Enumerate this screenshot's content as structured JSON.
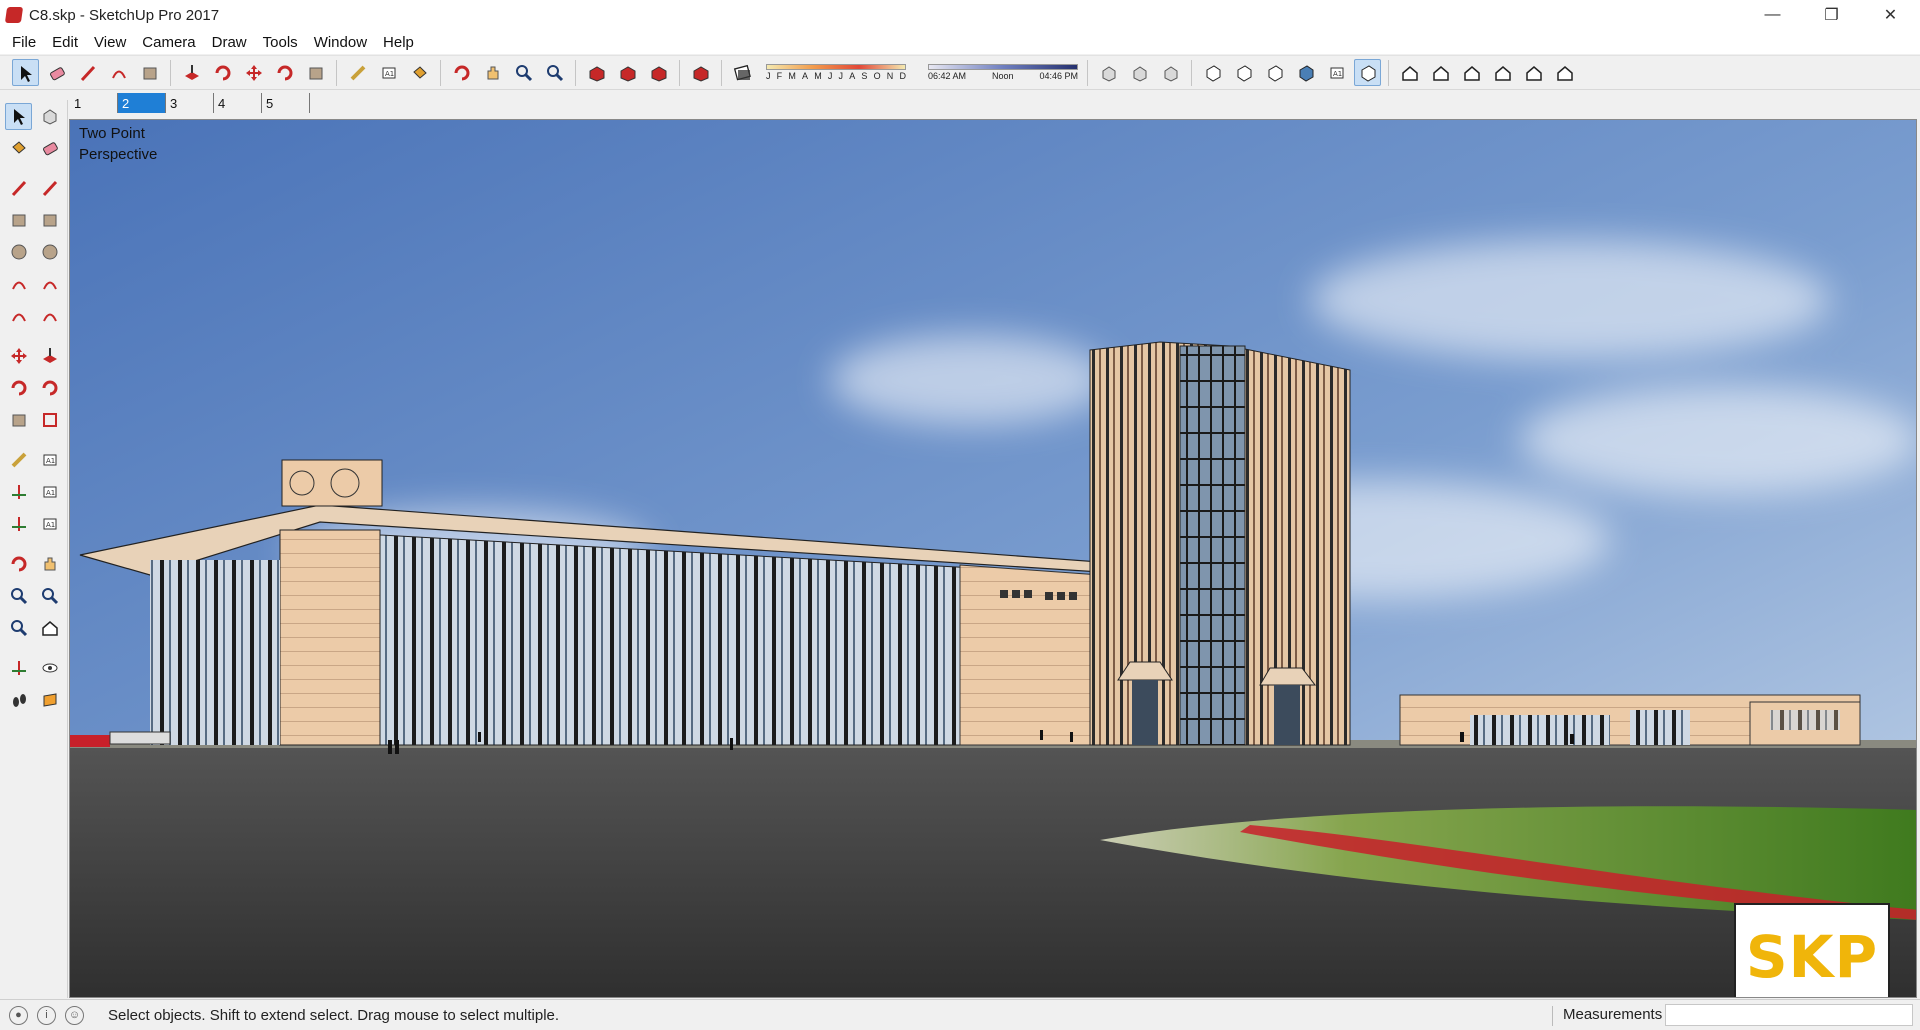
{
  "window": {
    "title": "C8.skp - SketchUp Pro 2017",
    "minimize": "—",
    "maximize": "❐",
    "close": "✕"
  },
  "menu": [
    "File",
    "Edit",
    "View",
    "Camera",
    "Draw",
    "Tools",
    "Window",
    "Help"
  ],
  "toolbar": {
    "groups": [
      [
        "select-icon",
        "eraser-icon",
        "pencil-icon",
        "arc-icon",
        "rectangle-icon"
      ],
      [
        "push-pull-icon",
        "follow-me-icon",
        "move-icon",
        "rotate-icon",
        "scale-icon"
      ],
      [
        "tape-measure-icon",
        "text-icon",
        "paint-bucket-icon"
      ],
      [
        "orbit-icon",
        "pan-icon",
        "zoom-icon",
        "zoom-extents-icon"
      ],
      [
        "warehouse-icon",
        "extension-warehouse-icon",
        "layout-icon"
      ],
      [
        "ruby-icon"
      ]
    ],
    "shadow": {
      "months": [
        "J",
        "F",
        "M",
        "A",
        "M",
        "J",
        "J",
        "A",
        "S",
        "O",
        "N",
        "D"
      ],
      "time_start": "06:42 AM",
      "time_mid": "Noon",
      "time_end": "04:46 PM"
    },
    "groups_right": [
      [
        "terrain-icon",
        "tag-icon",
        "import-icon"
      ],
      [
        "xray-icon",
        "wireframe-icon",
        "hidden-line-icon",
        "shaded-icon",
        "textured-icon",
        "monochrome-icon"
      ],
      [
        "iso-view-icon",
        "top-view-icon",
        "front-view-icon",
        "right-view-icon",
        "back-view-icon",
        "left-view-icon"
      ]
    ]
  },
  "scenes": [
    "1",
    "2",
    "3",
    "4",
    "5"
  ],
  "active_scene": "2",
  "viewport": {
    "perspective_line1": "Two Point",
    "perspective_line2": "Perspective",
    "logo_text": "SKP"
  },
  "left_tools": [
    [
      "select-icon",
      "component-icon"
    ],
    [
      "paint-bucket-icon",
      "eraser-icon"
    ],
    [
      "line-icon",
      "freehand-icon"
    ],
    [
      "rectangle-icon",
      "rotated-rectangle-icon"
    ],
    [
      "circle-icon",
      "polygon-icon"
    ],
    [
      "arc-icon",
      "two-point-arc-icon"
    ],
    [
      "three-point-arc-icon",
      "pie-icon"
    ],
    [
      "move-icon",
      "push-pull-icon"
    ],
    [
      "rotate-icon",
      "follow-me-icon"
    ],
    [
      "scale-icon",
      "offset-icon"
    ],
    [
      "tape-measure-icon",
      "dimension-icon"
    ],
    [
      "protractor-icon",
      "text-icon"
    ],
    [
      "axes-icon",
      "3d-text-icon"
    ],
    [
      "orbit-icon",
      "pan-icon"
    ],
    [
      "zoom-icon",
      "zoom-window-icon"
    ],
    [
      "zoom-extents-icon",
      "previous-view-icon"
    ],
    [
      "position-camera-icon",
      "look-around-icon"
    ],
    [
      "walk-icon",
      "section-plane-icon"
    ]
  ],
  "status": {
    "hint": "Select objects. Shift to extend select. Drag mouse to select multiple.",
    "measurements_label": "Measurements",
    "measurements_value": ""
  },
  "colors": {
    "sky_top": "#4d77bd",
    "facade": "#e8c9a8",
    "glass": "#5a6f86",
    "road": "#3e3e3e",
    "grass": "#5e8f2e",
    "accent_red": "#c8202a",
    "logo_yellow": "#f0b50a"
  }
}
